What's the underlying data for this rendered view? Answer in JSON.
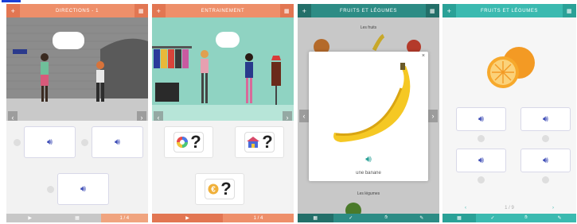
{
  "screens": [
    {
      "header": {
        "title": "DIRECTIONS - 1",
        "left_icon": "plus-icon",
        "right_icon": "menu-icon"
      },
      "footer": {
        "play": "▶",
        "grid": "▦",
        "count": "1 / 4"
      },
      "answers": [
        "sound",
        "sound",
        "sound"
      ]
    },
    {
      "header": {
        "title": "ENTRAINEMENT",
        "left_icon": "plus-icon",
        "right_icon": "menu-icon"
      },
      "footer": {
        "play": "▶",
        "count": "1 / 4"
      },
      "answers": [
        "?",
        "?",
        "?"
      ]
    },
    {
      "header": {
        "title": "FRUITS ET LÉGUMES",
        "left_icon": "plus-icon",
        "right_icon": "menu-icon"
      },
      "section_fruits": "Les fruits",
      "section_vegetables": "Les légumes",
      "modal": {
        "caption": "une banane",
        "close": "×"
      }
    },
    {
      "header": {
        "title": "FRUITS ET LÉGUMES",
        "left_icon": "plus-icon",
        "right_icon": "menu-icon"
      },
      "pager": {
        "prev": "‹",
        "count": "1 / 9",
        "next": "›"
      }
    }
  ],
  "colors": {
    "orange_header": "#ee8f6a",
    "teal_header": "#3bbab0",
    "sound_blue": "#3a49b5"
  }
}
